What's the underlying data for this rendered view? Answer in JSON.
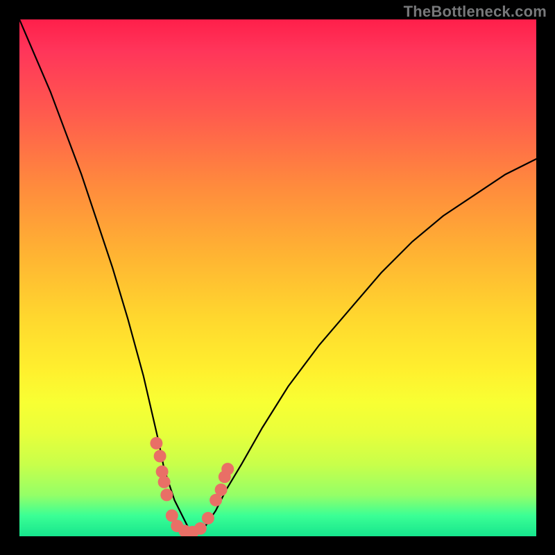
{
  "watermark": "TheBottleneck.com",
  "chart_data": {
    "type": "line",
    "title": "",
    "xlabel": "",
    "ylabel": "",
    "xlim": [
      0,
      100
    ],
    "ylim": [
      0,
      100
    ],
    "note": "Axes unlabeled in source image; x and curve values are estimated from pixel positions (0–100 plot-relative). Background gradient encodes a green→red scale; curve depicts a bottleneck-style dip to ~0 near x≈33.",
    "series": [
      {
        "name": "curve",
        "x": [
          0,
          3,
          6,
          9,
          12,
          15,
          18,
          21,
          24,
          27,
          28,
          30,
          32,
          33,
          34,
          36,
          38,
          40,
          43,
          47,
          52,
          58,
          64,
          70,
          76,
          82,
          88,
          94,
          100
        ],
        "values": [
          100,
          93,
          86,
          78,
          70,
          61,
          52,
          42,
          31,
          18,
          13,
          7,
          3,
          1,
          1,
          2,
          5,
          9,
          14,
          21,
          29,
          37,
          44,
          51,
          57,
          62,
          66,
          70,
          73
        ]
      }
    ],
    "markers": {
      "name": "highlight-dots",
      "color": "#e96f66",
      "points": [
        {
          "x": 26.5,
          "y": 18.0
        },
        {
          "x": 27.2,
          "y": 15.5
        },
        {
          "x": 27.6,
          "y": 12.5
        },
        {
          "x": 28.0,
          "y": 10.5
        },
        {
          "x": 28.5,
          "y": 8.0
        },
        {
          "x": 29.5,
          "y": 4.0
        },
        {
          "x": 30.5,
          "y": 2.0
        },
        {
          "x": 32.0,
          "y": 1.0
        },
        {
          "x": 33.5,
          "y": 0.8
        },
        {
          "x": 35.0,
          "y": 1.5
        },
        {
          "x": 36.5,
          "y": 3.5
        },
        {
          "x": 38.0,
          "y": 7.0
        },
        {
          "x": 39.0,
          "y": 9.0
        },
        {
          "x": 39.7,
          "y": 11.5
        },
        {
          "x": 40.3,
          "y": 13.0
        }
      ]
    },
    "gradient_stops": [
      {
        "pos": 0.0,
        "color": "#ff1f4a"
      },
      {
        "pos": 0.32,
        "color": "#ff8a3d"
      },
      {
        "pos": 0.58,
        "color": "#ffd82e"
      },
      {
        "pos": 0.8,
        "color": "#e8ff3b"
      },
      {
        "pos": 0.96,
        "color": "#3bff95"
      },
      {
        "pos": 1.0,
        "color": "#16e58d"
      }
    ]
  }
}
